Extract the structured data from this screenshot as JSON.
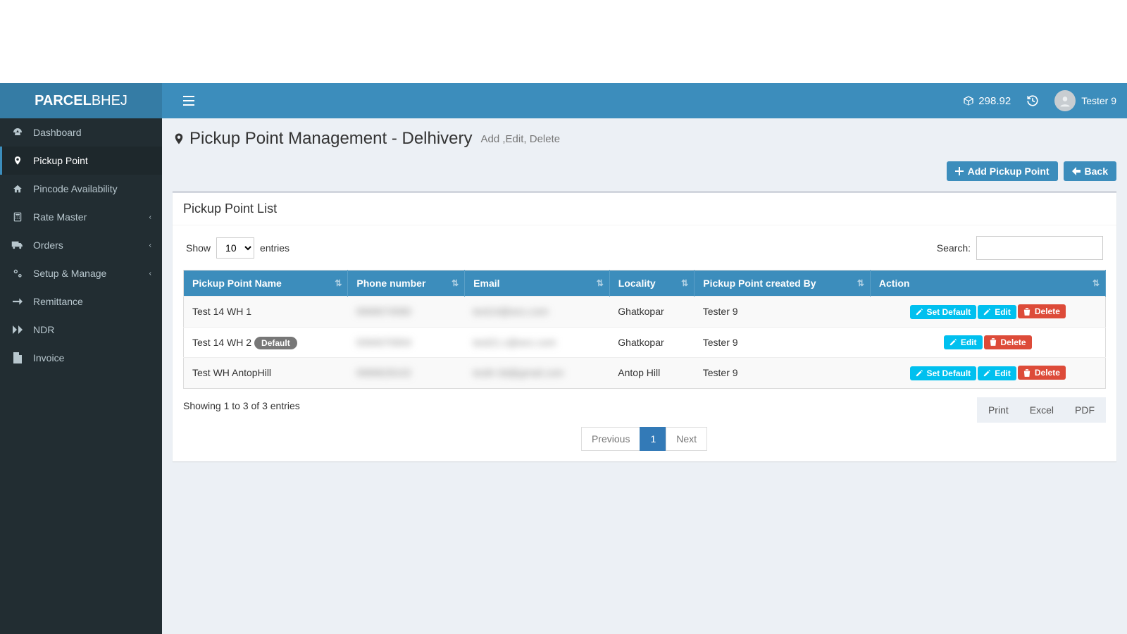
{
  "brand": {
    "strong": "PARCEL",
    "light": "BHEJ"
  },
  "header": {
    "balance": "298.92",
    "username": "Tester 9"
  },
  "sidebar": {
    "items": [
      {
        "label": "Dashboard",
        "icon": "dashboard",
        "active": false
      },
      {
        "label": "Pickup Point",
        "icon": "marker",
        "active": true
      },
      {
        "label": "Pincode Availability",
        "icon": "home",
        "active": false
      },
      {
        "label": "Rate Master",
        "icon": "calc",
        "active": false,
        "chevron": true
      },
      {
        "label": "Orders",
        "icon": "truck",
        "active": false,
        "chevron": true
      },
      {
        "label": "Setup & Manage",
        "icon": "cogs",
        "active": false,
        "chevron": true
      },
      {
        "label": "Remittance",
        "icon": "arrow-right",
        "active": false
      },
      {
        "label": "NDR",
        "icon": "forward",
        "active": false
      },
      {
        "label": "Invoice",
        "icon": "file",
        "active": false
      }
    ]
  },
  "page": {
    "title": "Pickup Point Management - Delhivery",
    "subtitle": "Add ,Edit, Delete",
    "add_label": "Add Pickup Point",
    "back_label": "Back",
    "box_title": "Pickup Point List"
  },
  "datatable": {
    "length_prefix": "Show",
    "length_value": "10",
    "length_suffix": "entries",
    "search_label": "Search:",
    "columns": [
      "Pickup Point Name",
      "Phone number",
      "Email",
      "Locality",
      "Pickup Point created By",
      "Action"
    ],
    "rows": [
      {
        "name": "Test 14 WH 1",
        "phone": "9999074580",
        "email": "test14@wcc.com",
        "locality": "Ghatkopar",
        "created_by": "Tester 9",
        "is_default": false
      },
      {
        "name": "Test 14 WH 2",
        "phone": "9394070904",
        "email": "test21.c@wcc.com",
        "locality": "Ghatkopar",
        "created_by": "Tester 9",
        "is_default": true
      },
      {
        "name": "Test WH AntopHill",
        "phone": "9989628102",
        "email": "testh-3d@gmail.com",
        "locality": "Antop Hill",
        "created_by": "Tester 9",
        "is_default": false
      }
    ],
    "actions": {
      "set_default": "Set Default",
      "edit": "Edit",
      "delete": "Delete",
      "default_badge": "Default"
    },
    "info": "Showing 1 to 3 of 3 entries",
    "export": {
      "print": "Print",
      "excel": "Excel",
      "pdf": "PDF"
    },
    "pagination": {
      "prev": "Previous",
      "current": "1",
      "next": "Next"
    }
  }
}
